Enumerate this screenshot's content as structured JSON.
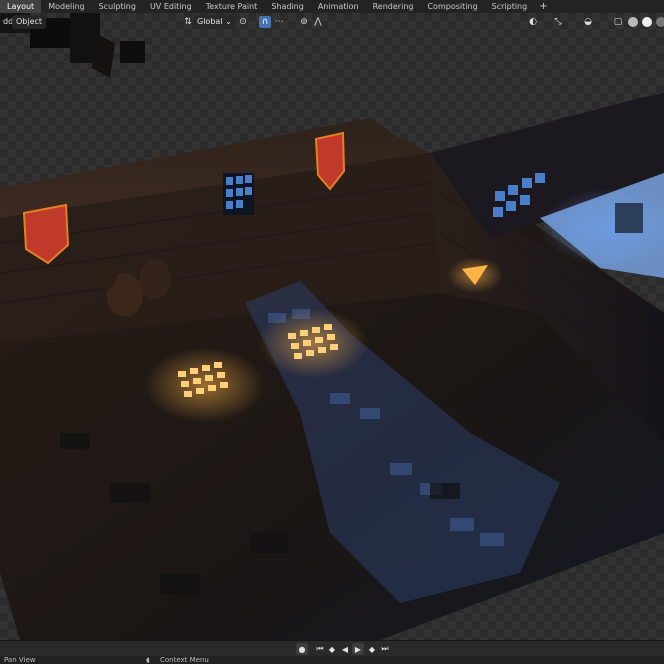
{
  "workspace_tabs": [
    "Layout",
    "Modeling",
    "Sculpting",
    "UV Editing",
    "Texture Paint",
    "Shading",
    "Animation",
    "Rendering",
    "Compositing",
    "Scripting"
  ],
  "active_tab": "Layout",
  "add_workspace": "+",
  "header": {
    "menu_add": "dd",
    "menu_object": "Object",
    "orientation": "Global"
  },
  "colors": {
    "accent": "#4772b3",
    "warm_light": "#ffb347",
    "cool_light": "#6fa8ff",
    "banner": "#c0392b"
  },
  "icons": {
    "orientation": "transform-orientation-icon",
    "pivot": "pivot-point-icon",
    "snap": "snap-magnet-icon",
    "snap_increment": "snap-increment-icon",
    "proportional": "proportional-edit-icon",
    "falloff": "falloff-curve-icon",
    "visibility": "object-visibility-icon",
    "gizmo": "gizmo-icon",
    "overlay": "overlay-icon",
    "xray": "xray-icon"
  },
  "timeline": {
    "buttons": [
      "record",
      "jump-start",
      "jump-keyframe-back",
      "play-reverse",
      "play",
      "jump-keyframe-forward",
      "jump-end"
    ]
  },
  "statusbar": {
    "left": "Pan View",
    "middle": "Context Menu"
  }
}
